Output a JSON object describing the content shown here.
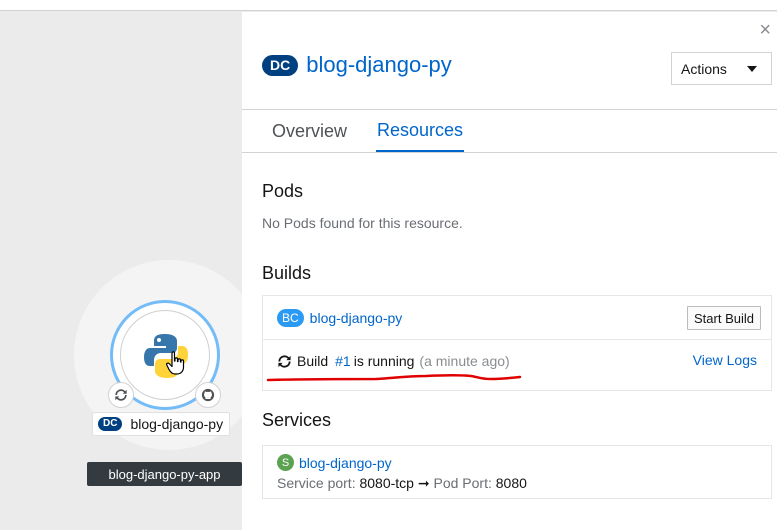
{
  "topology": {
    "node_badge": "DC",
    "node_label": "blog-django-py",
    "app_label": "blog-django-py-app",
    "node_icons": [
      "python-logo-icon",
      "sync-icon",
      "github-icon"
    ]
  },
  "panel": {
    "badge": "DC",
    "title": "blog-django-py",
    "close_label": "×",
    "actions_label": "Actions",
    "tabs": [
      {
        "label": "Overview",
        "active": false
      },
      {
        "label": "Resources",
        "active": true
      }
    ],
    "pods": {
      "title": "Pods",
      "empty_text": "No Pods found for this resource."
    },
    "builds": {
      "title": "Builds",
      "config_badge": "BC",
      "config_name": "blog-django-py",
      "start_build_label": "Start Build",
      "build_prefix": "Build",
      "build_number": "#1",
      "build_status": "is running",
      "build_time": "(a minute ago)",
      "view_logs_label": "View Logs"
    },
    "services": {
      "title": "Services",
      "badge": "S",
      "name": "blog-django-py",
      "service_port_label": "Service port:",
      "service_port": "8080-tcp",
      "arrow": "➞",
      "pod_port_label": "Pod Port:",
      "pod_port": "8080"
    }
  },
  "colors": {
    "accent": "#0066cc",
    "dc_badge": "#004080",
    "bc_badge": "#2b9af3",
    "service_badge": "#5ba352",
    "node_ring": "#73bcf7",
    "annotation_red": "#e00000"
  }
}
